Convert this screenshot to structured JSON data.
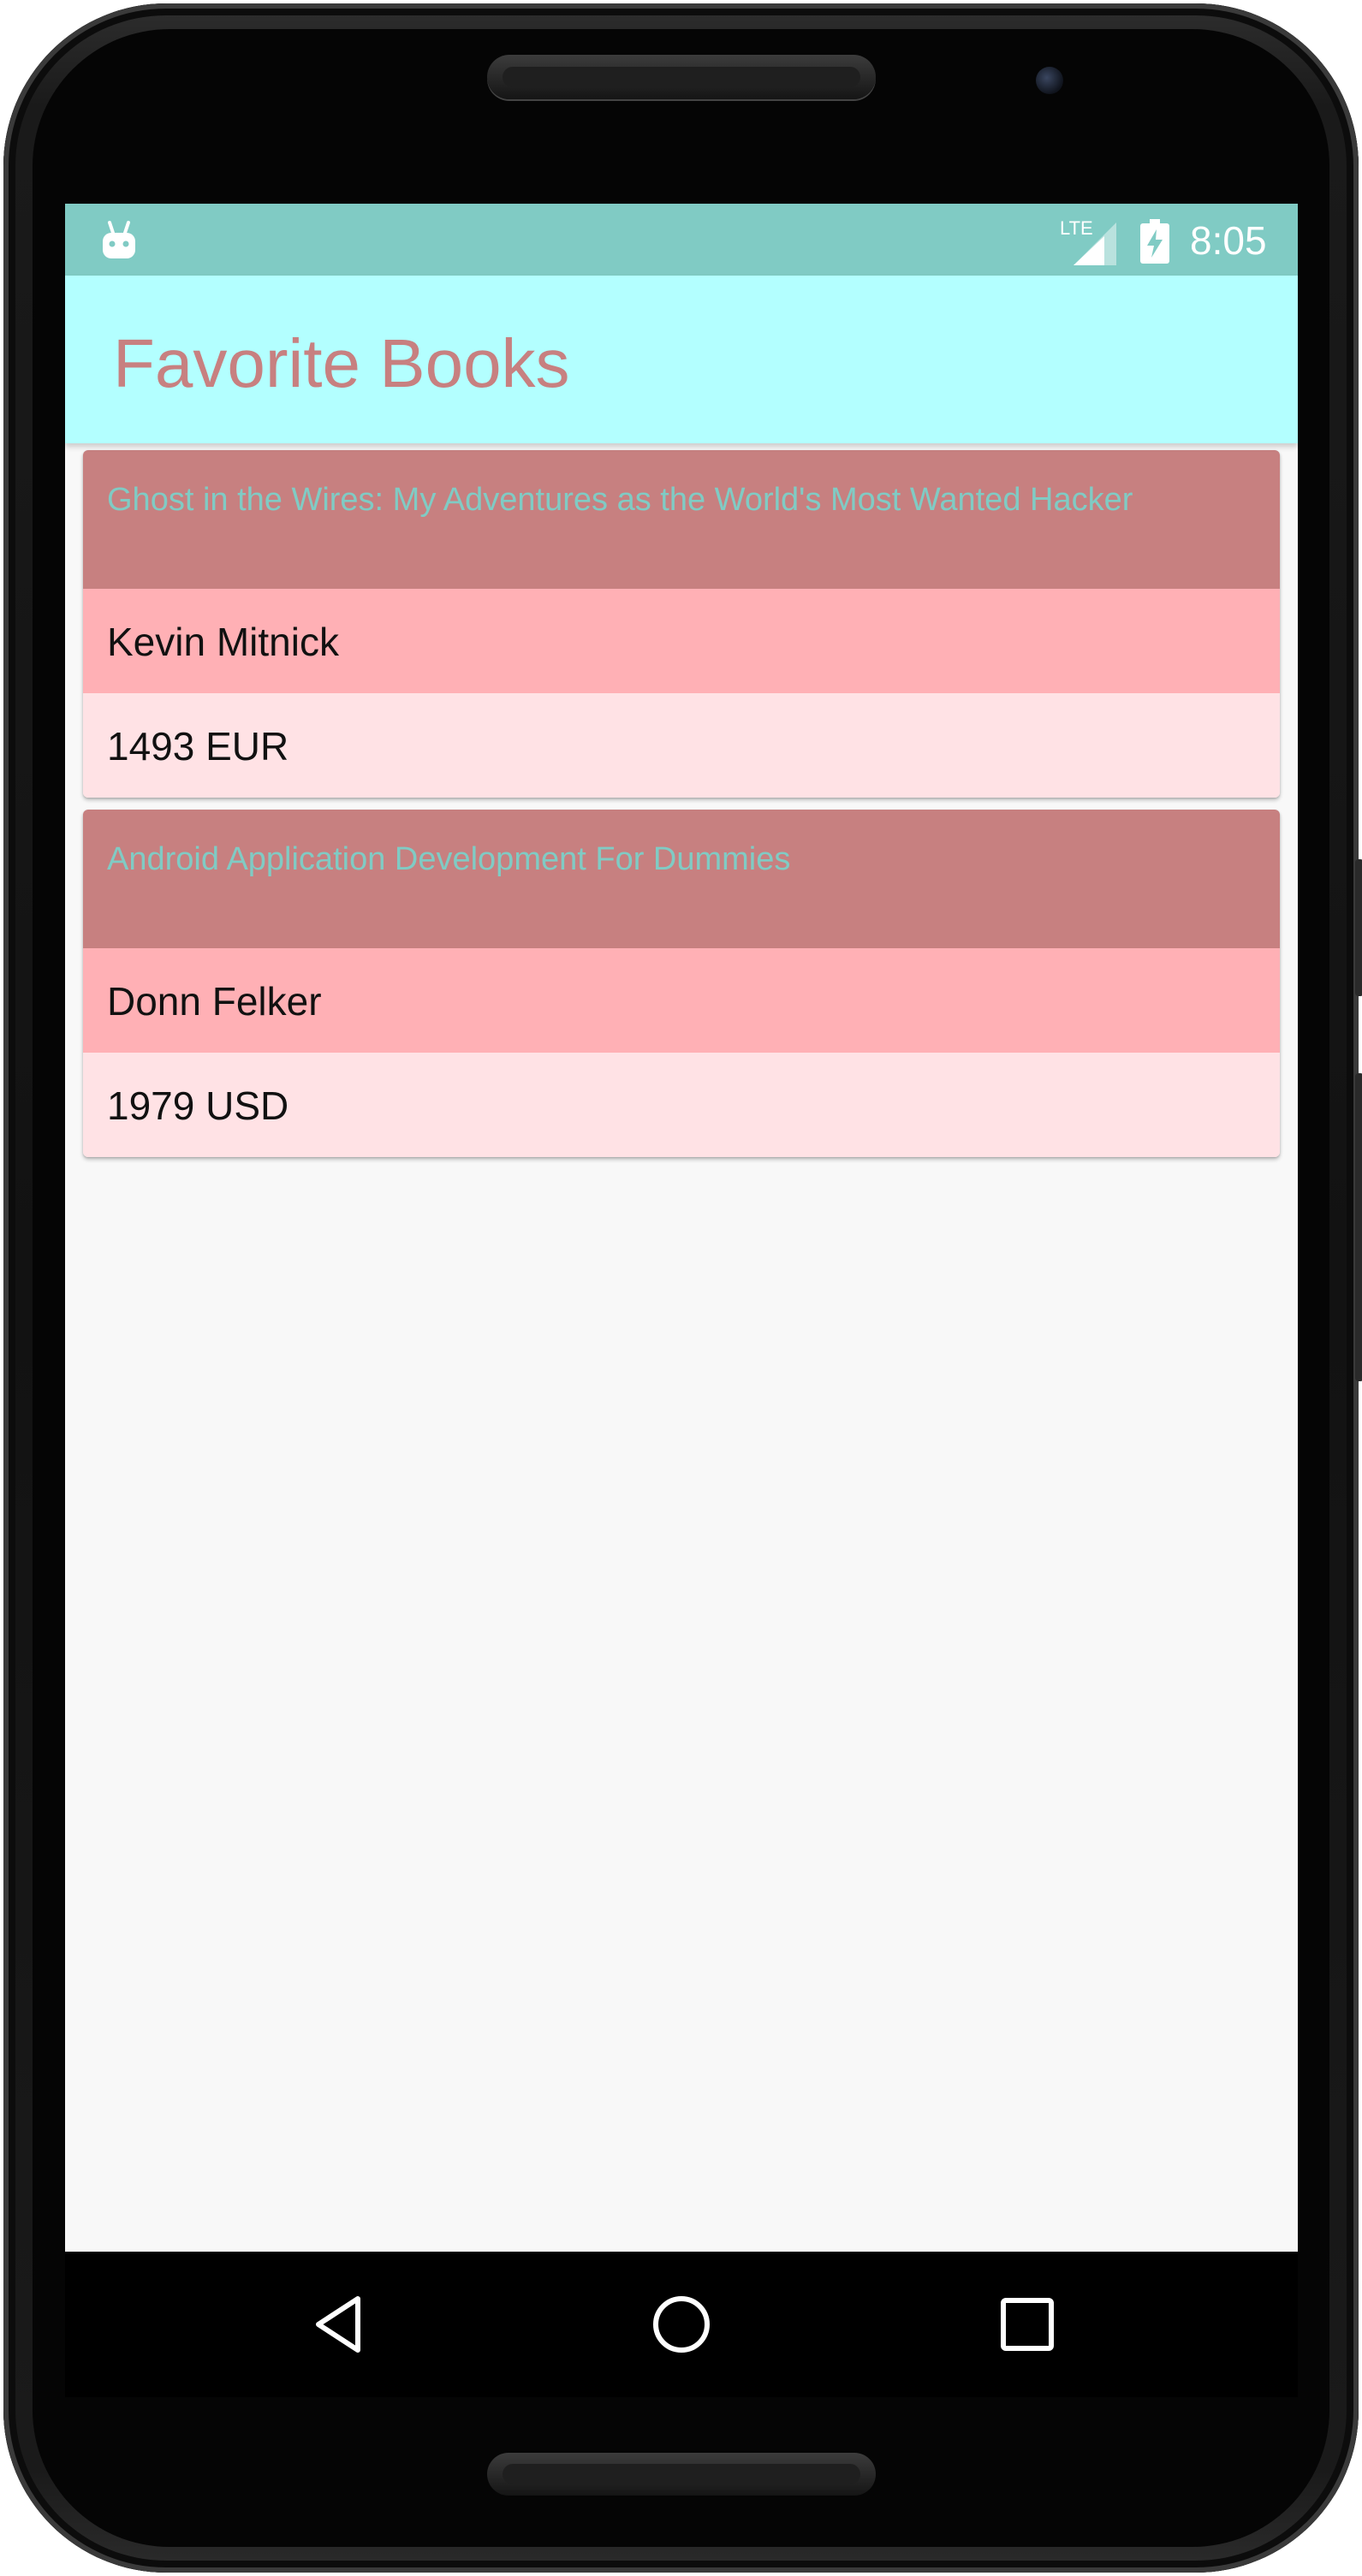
{
  "status_bar": {
    "time": "8:05",
    "network_label": "LTE",
    "icons": [
      "android-debug-icon",
      "lte-signal-icon",
      "battery-charging-icon"
    ]
  },
  "app_bar": {
    "title": "Favorite Books"
  },
  "books": [
    {
      "title": "Ghost in the Wires: My Adventures as the World's Most Wanted Hacker",
      "author": "Kevin Mitnick",
      "price": "1493 EUR"
    },
    {
      "title": "Android Application Development For Dummies",
      "author": "Donn Felker",
      "price": "1979 USD"
    }
  ],
  "nav_bar": {
    "icons": [
      "back-icon",
      "home-icon",
      "recents-icon"
    ]
  },
  "colors": {
    "status_bar": "#80cbc4",
    "app_bar": "#b3ffff",
    "title_text": "#c78080",
    "card_title_bg": "#c78080",
    "card_title_text": "#80cbc4",
    "card_author_bg": "#ffb0b5",
    "card_price_bg": "#ffe2e5",
    "background": "#f8f8f8"
  }
}
